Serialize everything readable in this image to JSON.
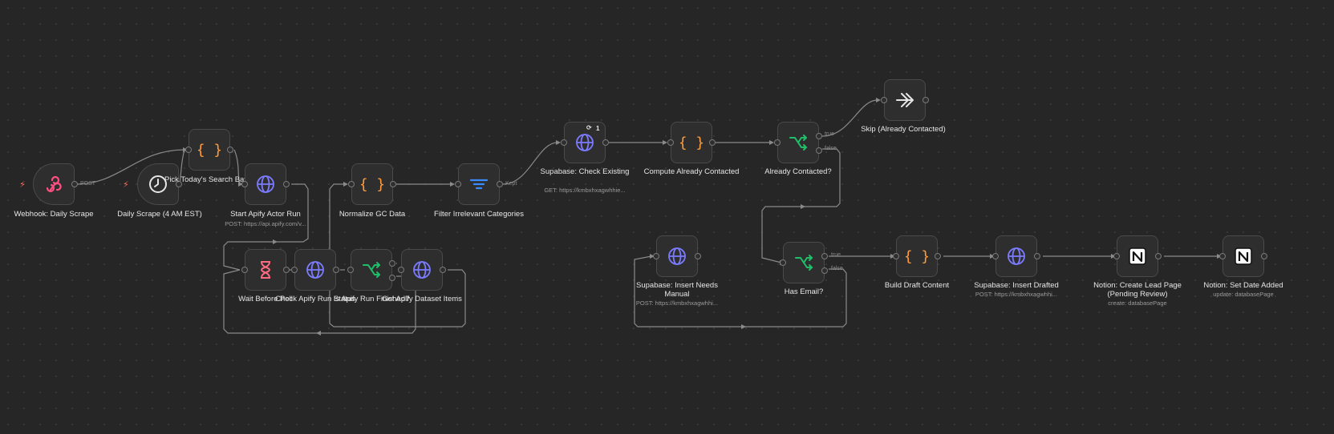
{
  "nodes": {
    "webhook": {
      "label": "Webhook: Daily Scrape",
      "port": "POST",
      "icon": "webhook-icon"
    },
    "daily_scrape": {
      "label": "Daily Scrape (4 AM EST)",
      "icon": "clock-icon"
    },
    "pick_batch": {
      "label": "Pick Today's Search Batch",
      "icon": "code-braces-icon"
    },
    "start_apify": {
      "label": "Start Apify Actor Run",
      "sub": "POST: https://api.apify.com/v...",
      "icon": "globe-icon"
    },
    "wait_before": {
      "label": "Wait Before Poll",
      "icon": "hourglass-icon"
    },
    "check_status": {
      "label": "Check Apify Run Status",
      "icon": "globe-icon"
    },
    "is_finished": {
      "label": "Is Apify Run Finished?",
      "icon": "switch-icon"
    },
    "get_dataset": {
      "label": "Get Apify Dataset Items",
      "icon": "globe-icon"
    },
    "normalize": {
      "label": "Normalize GC Data",
      "icon": "code-braces-icon"
    },
    "filter": {
      "label": "Filter Irrelevant Categories",
      "port": "Kept",
      "icon": "filter-icon"
    },
    "supabase_check": {
      "label": "Supabase: Check Existing",
      "sub": "GET: https://kmbxhxagwhhie...",
      "badge": "1",
      "icon": "globe-icon"
    },
    "compute_contacted": {
      "label": "Compute Already Contacted",
      "icon": "code-braces-icon"
    },
    "already_contacted": {
      "label": "Already Contacted?",
      "port_true": "true",
      "port_false": "false",
      "icon": "switch-icon"
    },
    "skip": {
      "label": "Skip (Already Contacted)",
      "icon": "double-arrow-icon"
    },
    "insert_manual": {
      "label": "Supabase: Insert Needs Manual",
      "sub": "POST: https://kmbxhxagwhhi...",
      "icon": "globe-icon"
    },
    "has_email": {
      "label": "Has Email?",
      "port_true": "true",
      "port_false": "false",
      "icon": "switch-icon"
    },
    "build_draft": {
      "label": "Build Draft Content",
      "icon": "code-braces-icon"
    },
    "insert_drafted": {
      "label": "Supabase: Insert Drafted",
      "sub": "POST: https://kmbxhxagwhhi...",
      "icon": "globe-icon"
    },
    "notion_create": {
      "label": "Notion: Create Lead Page (Pending Review)",
      "sub": "create: databasePage",
      "icon": "notion-icon"
    },
    "notion_set": {
      "label": "Notion: Set Date Added",
      "sub": "update: databasePage",
      "icon": "notion-icon"
    }
  },
  "colors": {
    "webhook": "#ff4f81",
    "code": "#ff9b3d",
    "http": "#7b7bff",
    "switch": "#1fbf6a",
    "filter": "#3b8bff",
    "wait": "#ff6b81",
    "trigger_bolt": "#ff6d5a"
  }
}
